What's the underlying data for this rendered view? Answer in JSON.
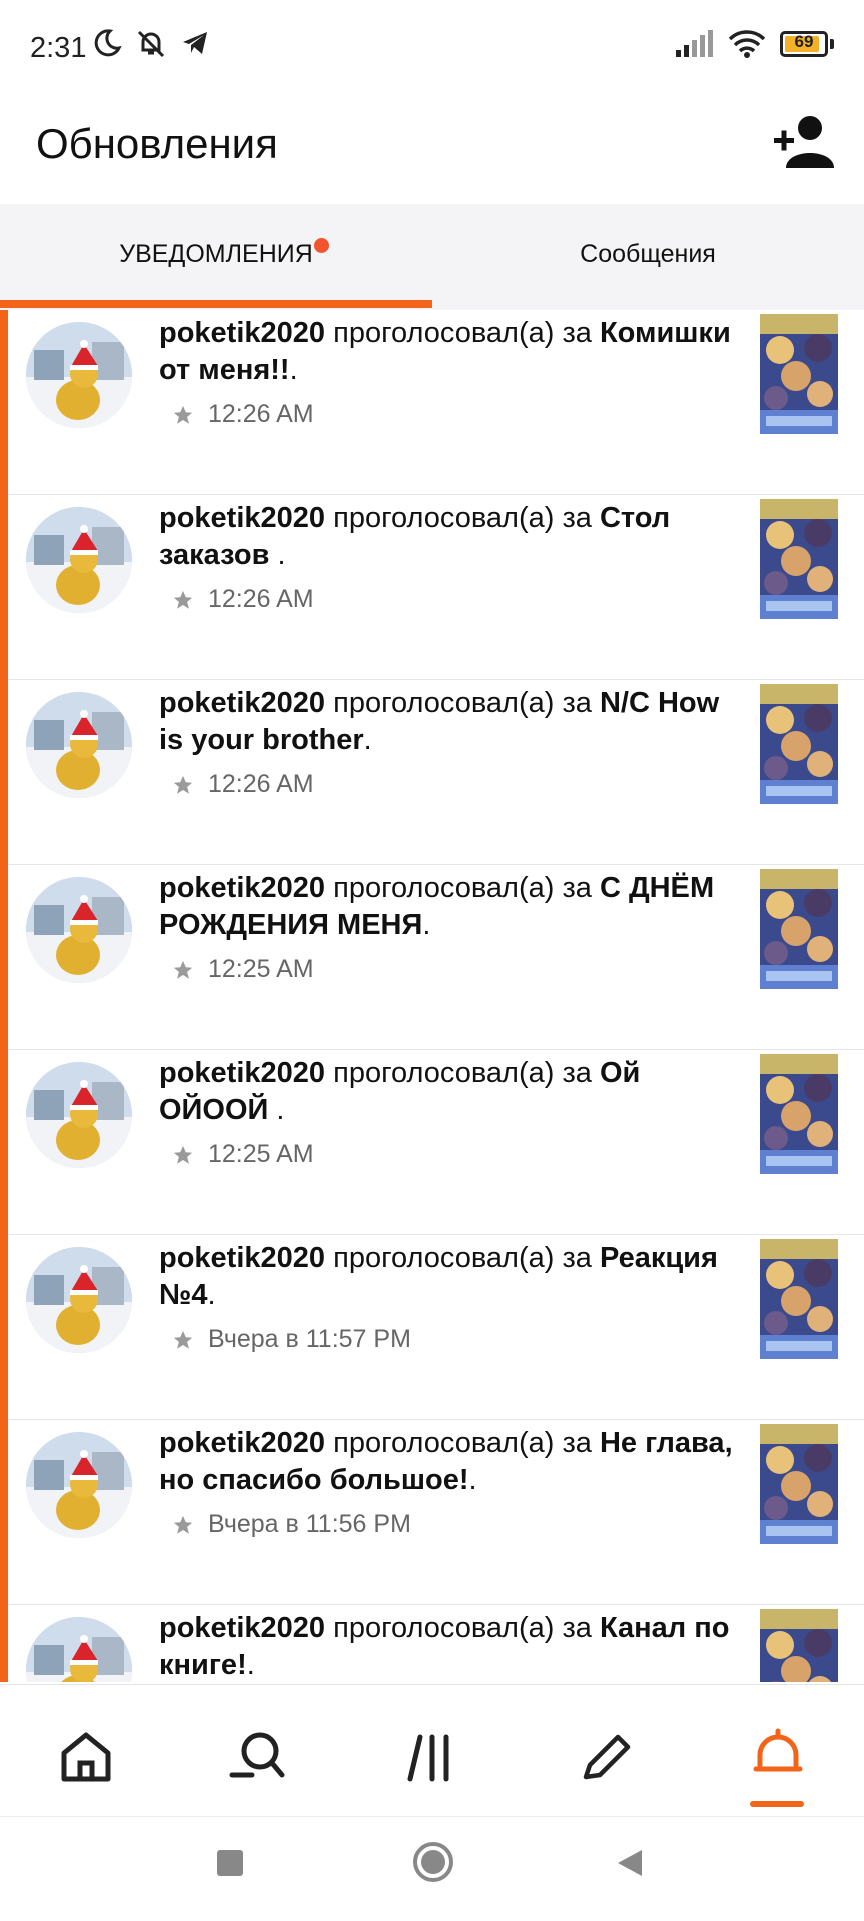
{
  "status_bar": {
    "time": "2:31",
    "battery": "69",
    "icons": [
      "moon-icon",
      "bell-off-icon",
      "telegram-icon",
      "signal-icon",
      "wifi-icon",
      "battery-icon"
    ]
  },
  "header": {
    "title": "Обновления",
    "add_user_icon": "add-user-icon"
  },
  "tabs": [
    {
      "label": "УВЕДОМЛЕНИЯ",
      "active": true,
      "has_dot": true
    },
    {
      "label": "Сообщения",
      "active": false
    }
  ],
  "notifications": [
    {
      "user": "poketik2020",
      "action": "проголосовал(а) за",
      "title": "Комишки от меня!!",
      "suffix": ".",
      "time": "12:26 AM"
    },
    {
      "user": "poketik2020",
      "action": "проголосовал(а) за",
      "title": "Стол заказов",
      "suffix": " .",
      "time": "12:26 AM"
    },
    {
      "user": "poketik2020",
      "action": "проголосовал(а) за",
      "title": "N/C How is your brother",
      "suffix": ".",
      "time": "12:26 AM"
    },
    {
      "user": "poketik2020",
      "action": "проголосовал(а) за",
      "title": "С ДНЁМ РОЖДЕНИЯ МЕНЯ",
      "suffix": ".",
      "time": "12:25 AM"
    },
    {
      "user": "poketik2020",
      "action": "проголосовал(а) за",
      "title": "Ой ОЙООЙ",
      "suffix": " .",
      "time": "12:25 AM"
    },
    {
      "user": "poketik2020",
      "action": "проголосовал(а) за",
      "title": "Реакция №4",
      "suffix": ".",
      "time": "Вчера в 11:57 PM"
    },
    {
      "user": "poketik2020",
      "action": "проголосовал(а) за",
      "title": "Не глава, но спасибо большое!",
      "suffix": ".",
      "time": "Вчера в 11:56 PM"
    },
    {
      "user": "poketik2020",
      "action": "проголосовал(а) за",
      "title": "Канал по книге!",
      "suffix": ".",
      "time": ""
    }
  ],
  "bottom_nav": [
    {
      "name": "home",
      "icon": "home-icon",
      "active": false
    },
    {
      "name": "discover",
      "icon": "search-icon",
      "active": false
    },
    {
      "name": "library",
      "icon": "library-icon",
      "active": false
    },
    {
      "name": "write",
      "icon": "pencil-icon",
      "active": false
    },
    {
      "name": "notifications",
      "icon": "bell-icon",
      "active": true
    }
  ],
  "colors": {
    "accent": "#f26419",
    "dot": "#f2542d",
    "tab_bg": "#f4f4f6"
  }
}
